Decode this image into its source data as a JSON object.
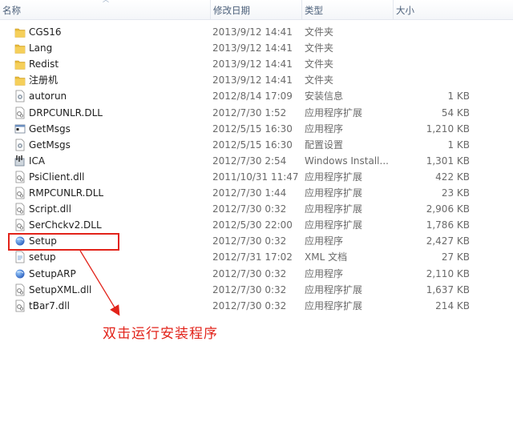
{
  "columns": {
    "name": "名称",
    "date": "修改日期",
    "type": "类型",
    "size": "大小"
  },
  "files": [
    {
      "name": "CGS16",
      "date": "2013/9/12 14:41",
      "type": "文件夹",
      "size": "",
      "icon": "folder-icon"
    },
    {
      "name": "Lang",
      "date": "2013/9/12 14:41",
      "type": "文件夹",
      "size": "",
      "icon": "folder-icon"
    },
    {
      "name": "Redist",
      "date": "2013/9/12 14:41",
      "type": "文件夹",
      "size": "",
      "icon": "folder-icon"
    },
    {
      "name": "注册机",
      "date": "2013/9/12 14:41",
      "type": "文件夹",
      "size": "",
      "icon": "folder-icon"
    },
    {
      "name": "autorun",
      "date": "2012/8/14 17:09",
      "type": "安装信息",
      "size": "1 KB",
      "icon": "settings-file-icon"
    },
    {
      "name": "DRPCUNLR.DLL",
      "date": "2012/7/30 1:52",
      "type": "应用程序扩展",
      "size": "54 KB",
      "icon": "dll-file-icon"
    },
    {
      "name": "GetMsgs",
      "date": "2012/5/15 16:30",
      "type": "应用程序",
      "size": "1,210 KB",
      "icon": "app-window-icon"
    },
    {
      "name": "GetMsgs",
      "date": "2012/5/15 16:30",
      "type": "配置设置",
      "size": "1 KB",
      "icon": "settings-file-icon"
    },
    {
      "name": "ICA",
      "date": "2012/7/30 2:54",
      "type": "Windows Install...",
      "size": "1,301 KB",
      "icon": "installer-icon"
    },
    {
      "name": "PsiClient.dll",
      "date": "2011/10/31 11:47",
      "type": "应用程序扩展",
      "size": "422 KB",
      "icon": "dll-file-icon"
    },
    {
      "name": "RMPCUNLR.DLL",
      "date": "2012/7/30 1:44",
      "type": "应用程序扩展",
      "size": "23 KB",
      "icon": "dll-file-icon"
    },
    {
      "name": "Script.dll",
      "date": "2012/7/30 0:32",
      "type": "应用程序扩展",
      "size": "2,906 KB",
      "icon": "dll-file-icon"
    },
    {
      "name": "SerChckv2.DLL",
      "date": "2012/5/30 22:00",
      "type": "应用程序扩展",
      "size": "1,786 KB",
      "icon": "dll-file-icon"
    },
    {
      "name": "Setup",
      "date": "2012/7/30 0:32",
      "type": "应用程序",
      "size": "2,427 KB",
      "icon": "setup-globe-icon"
    },
    {
      "name": "setup",
      "date": "2012/7/31 17:02",
      "type": "XML 文档",
      "size": "27 KB",
      "icon": "xml-file-icon"
    },
    {
      "name": "SetupARP",
      "date": "2012/7/30 0:32",
      "type": "应用程序",
      "size": "2,110 KB",
      "icon": "setup-globe-icon"
    },
    {
      "name": "SetupXML.dll",
      "date": "2012/7/30 0:32",
      "type": "应用程序扩展",
      "size": "1,637 KB",
      "icon": "dll-file-icon"
    },
    {
      "name": "tBar7.dll",
      "date": "2012/7/30 0:32",
      "type": "应用程序扩展",
      "size": "214 KB",
      "icon": "dll-file-icon"
    }
  ],
  "annotation": {
    "caption": "双击运行安装程序",
    "color": "#e2231a"
  }
}
